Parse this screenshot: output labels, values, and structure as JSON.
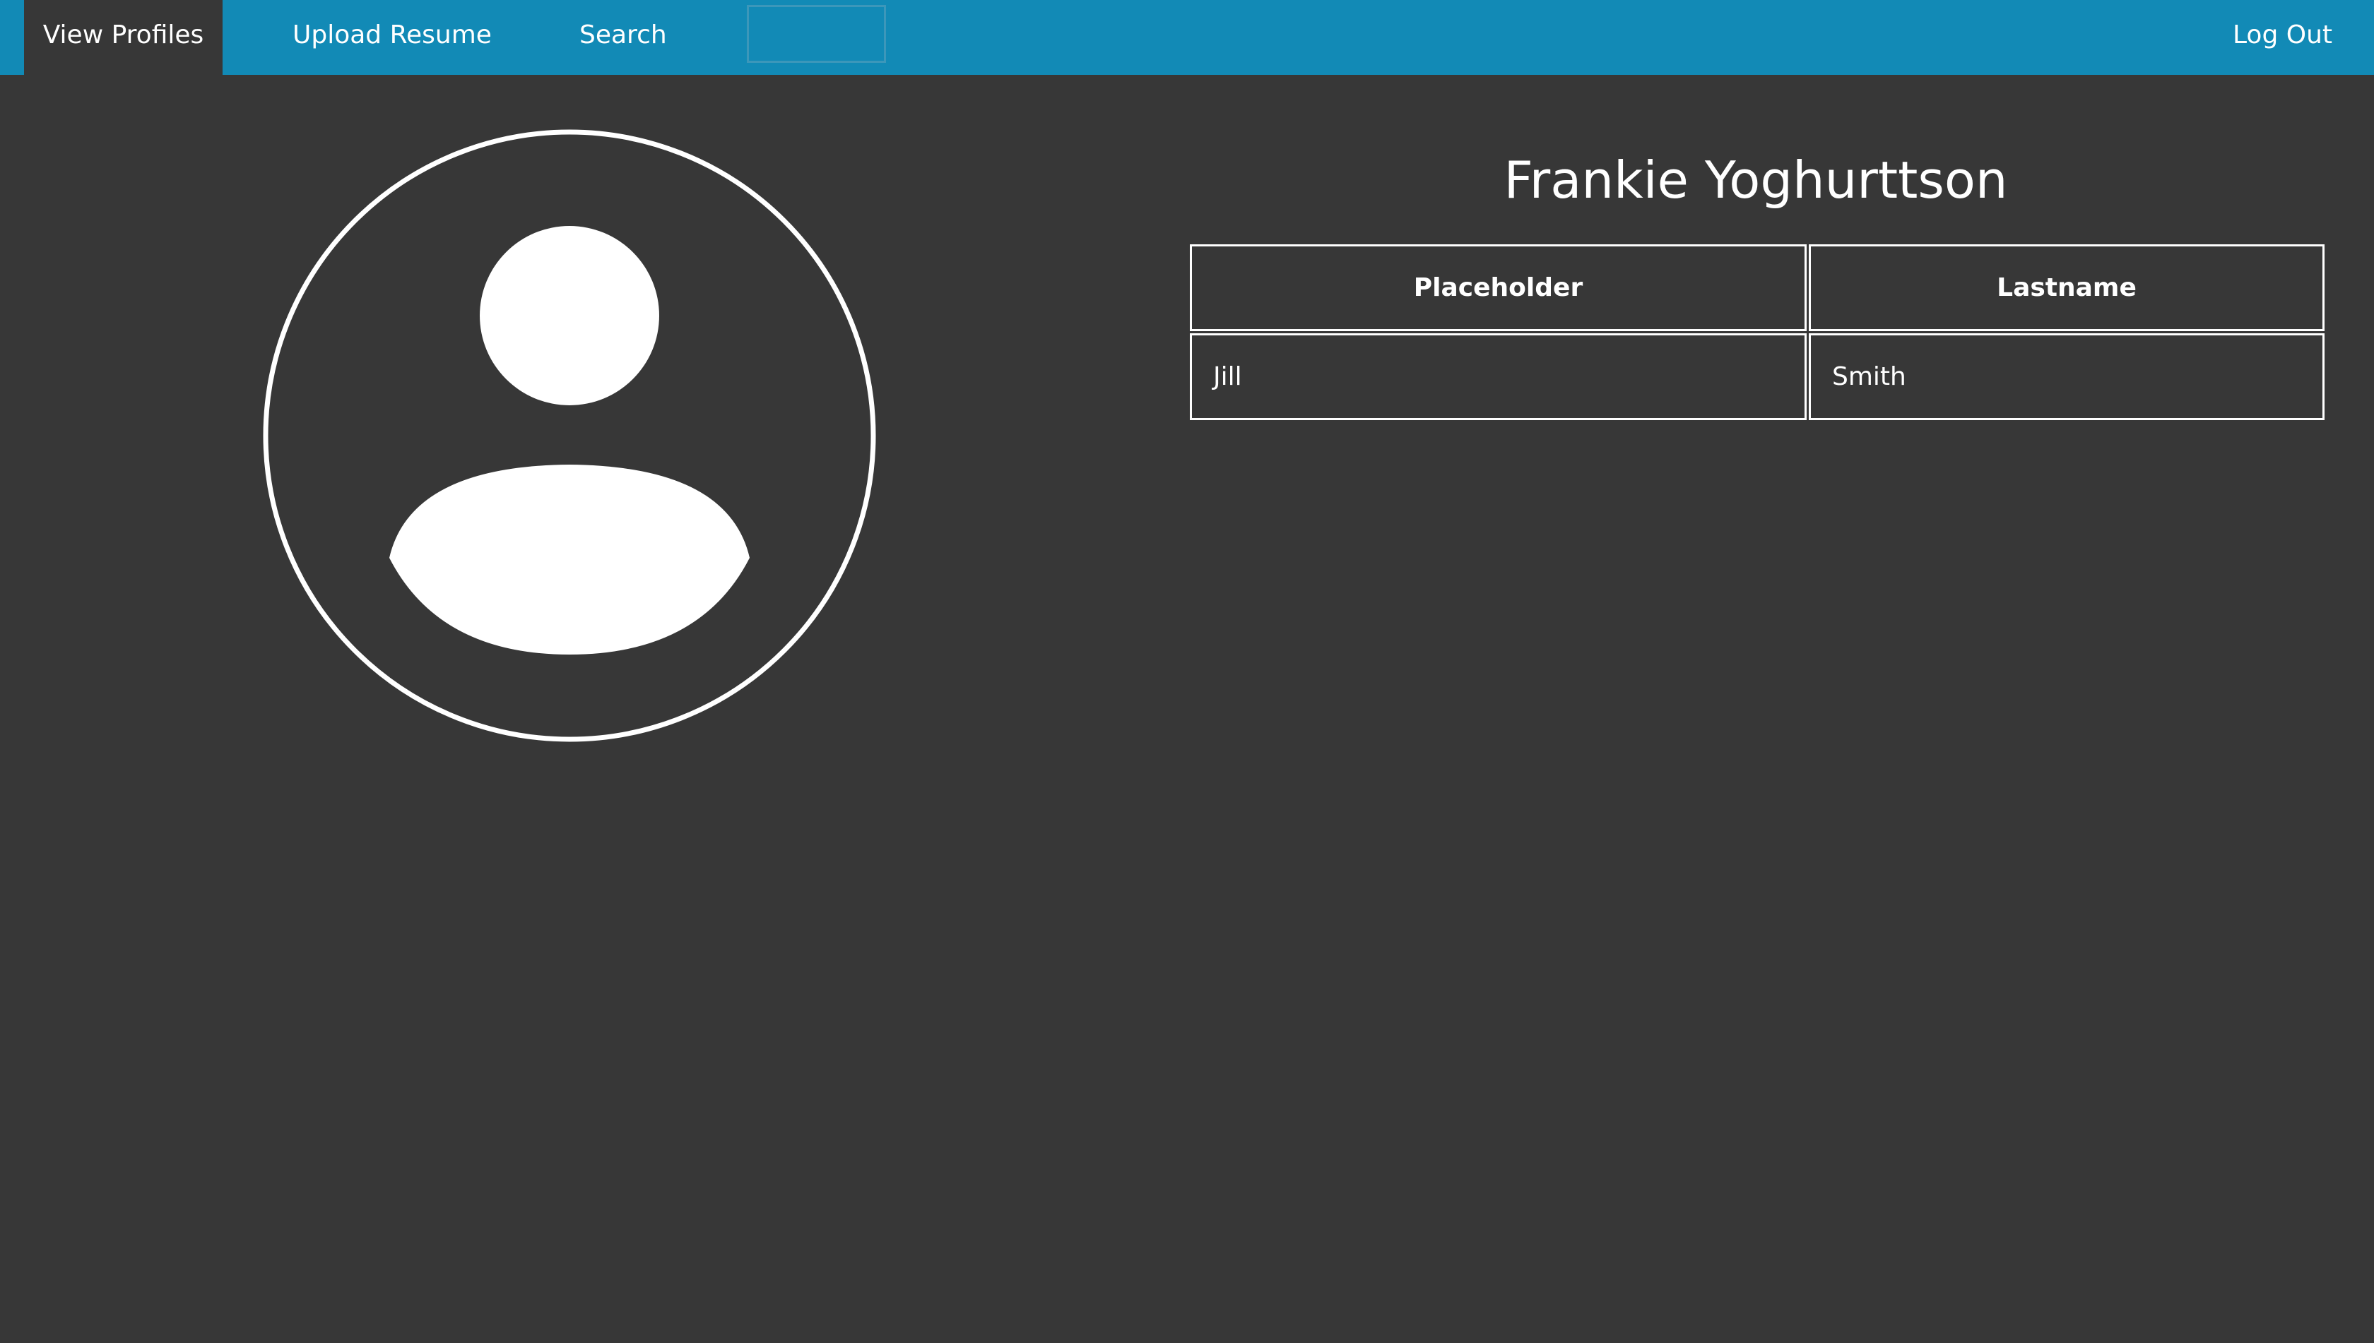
{
  "nav": {
    "items": [
      {
        "label": "View Profiles",
        "active": true
      },
      {
        "label": "Upload Resume",
        "active": false
      },
      {
        "label": "Search",
        "active": false
      }
    ],
    "search_input_value": "",
    "logout_label": "Log Out"
  },
  "profile": {
    "avatar_icon": "user-avatar-icon",
    "name": "Frankie Yoghurttson",
    "table": {
      "headers": [
        "Placeholder",
        "Lastname"
      ],
      "rows": [
        [
          "Jill",
          "Smith"
        ]
      ]
    }
  },
  "colors": {
    "navbar": "#128ab6",
    "background": "#373737",
    "text": "#ffffff"
  }
}
